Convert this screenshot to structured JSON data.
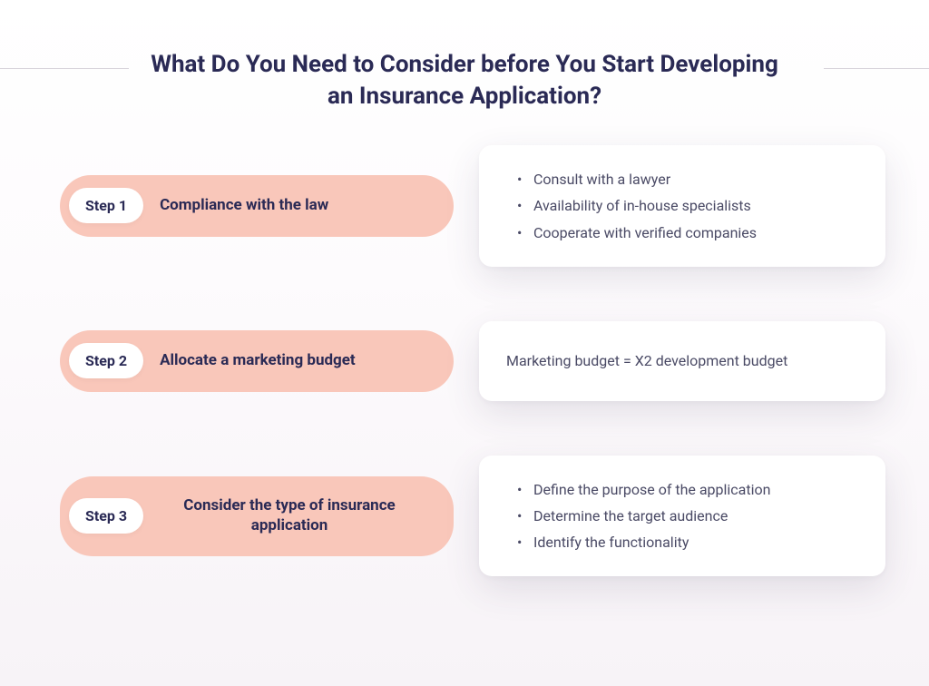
{
  "title": "What Do You Need to Consider before You Start Developing an Insurance Application?",
  "steps": [
    {
      "badge": "Step 1",
      "title": "Compliance with the law",
      "type": "list",
      "items": [
        "Consult with a lawyer",
        "Availability of in-house specialists",
        "Cooperate with verified companies"
      ]
    },
    {
      "badge": "Step 2",
      "title": "Allocate a marketing budget",
      "type": "text",
      "text": "Marketing budget = X2 development budget"
    },
    {
      "badge": "Step 3",
      "title": "Consider the type of insurance application",
      "type": "list",
      "items": [
        "Define the purpose of the application",
        "Determine the target audience",
        "Identify the functionality"
      ]
    }
  ]
}
